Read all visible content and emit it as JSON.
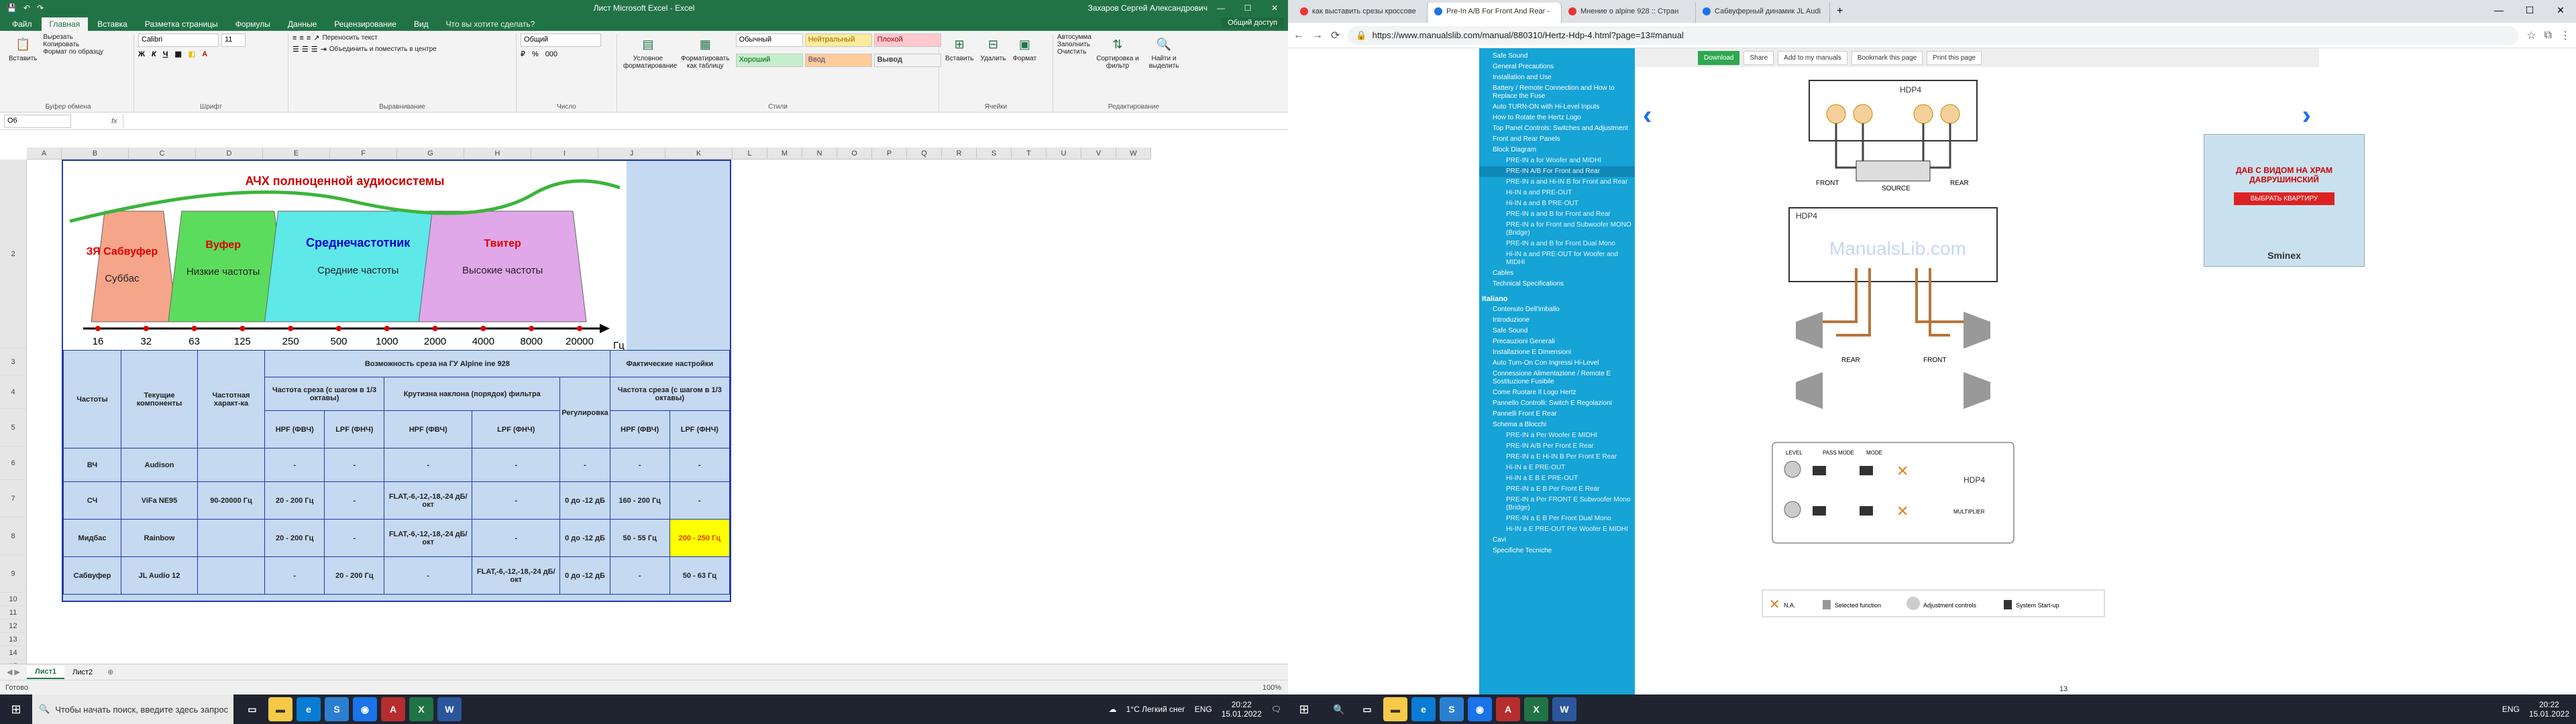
{
  "excel": {
    "title": "Лист Microsoft Excel - Excel",
    "user": "Захаров Сергей Александрович",
    "tabs": [
      "Файл",
      "Главная",
      "Вставка",
      "Разметка страницы",
      "Формулы",
      "Данные",
      "Рецензирование",
      "Вид"
    ],
    "tell_me": "Что вы хотите сделать?",
    "share": "Общий доступ",
    "ribbon": {
      "paste": "Вставить",
      "cut": "Вырезать",
      "copy": "Копировать",
      "format_painter": "Формат по образцу",
      "clipboard": "Буфер обмена",
      "font_name": "Calibri",
      "font_size": "11",
      "font_group": "Шрифт",
      "wrap": "Переносить текст",
      "merge": "Объединить и поместить в центре",
      "align_group": "Выравнивание",
      "number_format": "Общий",
      "number_group": "Число",
      "cond_format": "Условное форматирование",
      "format_table": "Форматировать как таблицу",
      "styles": [
        "Обычный",
        "Нейтральный",
        "Плохой",
        "Хороший",
        "Ввод",
        "Вывод"
      ],
      "styles_group": "Стили",
      "insert": "Вставить",
      "delete": "Удалить",
      "format": "Формат",
      "cells_group": "Ячейки",
      "autosum": "Автосумма",
      "fill": "Заполнить",
      "clear": "Очистить",
      "sort": "Сортировка и фильтр",
      "find": "Найти и выделить",
      "edit_group": "Редактирование"
    },
    "namebox": "O6",
    "fx": "fx",
    "columns": [
      "A",
      "B",
      "C",
      "D",
      "E",
      "F",
      "G",
      "H",
      "I",
      "J",
      "K",
      "L",
      "M",
      "N",
      "O",
      "P",
      "Q",
      "R",
      "S",
      "T",
      "U",
      "V",
      "W"
    ],
    "rows": [
      "2",
      "3",
      "4",
      "5",
      "6",
      "7",
      "8",
      "9",
      "10",
      "11",
      "12",
      "13",
      "14",
      "15"
    ],
    "chart": {
      "title": "АЧХ полноценной аудиосистемы",
      "bands": [
        {
          "name": "ЗЯ Сабвуфер",
          "sub": "Суббас",
          "color": "#f5a58a"
        },
        {
          "name": "Вуфер",
          "sub": "Низкие частоты",
          "color": "#5cdc5c"
        },
        {
          "name": "Среднечастотник",
          "sub": "Средние частоты",
          "color": "#5fe8e8"
        },
        {
          "name": "Твитер",
          "sub": "Высокие частоты",
          "color": "#e0a8e8"
        }
      ],
      "ticks": [
        "16",
        "32",
        "63",
        "125",
        "250",
        "500",
        "1000",
        "2000",
        "4000",
        "8000",
        "20000"
      ],
      "unit": "Гц"
    },
    "table": {
      "h_freq": "Частоты",
      "h_comp": "Текущие компоненты",
      "h_char": "Частотная характ-ка",
      "h_possible": "Возможность среза на ГУ Alpine ine 928",
      "h_actual": "Фактические настройки",
      "h_cut": "Частота среза (с шагом в 1/3 октавы)",
      "h_slope": "Крутизна наклона (порядок) фильтра",
      "h_reg": "Регулировка",
      "h_cut2": "Частота среза (с шагом в 1/3 октавы)",
      "hpf": "HPF (ФВЧ)",
      "lpf": "LPF (ФНЧ)",
      "rows": [
        [
          "ВЧ",
          "Audison",
          "",
          "-",
          "-",
          "-",
          "-",
          "-",
          "-",
          "-"
        ],
        [
          "СЧ",
          "ViFa NE95",
          "90-20000 Гц",
          "20 - 200 Гц",
          "-",
          "FLAT,-6,-12,-18,-24 дБ/окт",
          "-",
          "0 до -12 дБ",
          "160 - 200 Гц",
          "-"
        ],
        [
          "Мидбас",
          "Rainbow",
          "",
          "20 - 200 Гц",
          "-",
          "FLAT,-6,-12,-18,-24 дБ/окт",
          "-",
          "0 до -12 дБ",
          "50 - 55 Гц",
          "200 - 250 Гц"
        ],
        [
          "Сабвуфер",
          "JL Audio 12",
          "",
          "-",
          "20 - 200 Гц",
          "-",
          "FLAT,-6,-12,-18,-24 дБ/окт",
          "0 до -12 дБ",
          "-",
          "50 - 63 Гц"
        ]
      ]
    },
    "sheets": [
      "Лист1",
      "Лист2"
    ],
    "status": "Готово",
    "zoom": "100%"
  },
  "taskbar_left": {
    "search": "Чтобы начать поиск, введите здесь запрос",
    "weather": "1°C  Легкий снег",
    "lang": "ENG",
    "time": "20:22",
    "date": "15.01.2022"
  },
  "chrome": {
    "tabs": [
      "как выставить срезы кроссове",
      "Pre-In A/B For Front And Rear -",
      "Мнение о alpine 928 :: Стран",
      "Сабвуферный динамик JL Audi"
    ],
    "tab_colors": [
      "#e33",
      "#1a73e8",
      "#e33",
      "#1a73e8"
    ],
    "url": "https://www.manualslib.com/manual/880310/Hertz-Hdp-4.html?page=13#manual",
    "toolbar": [
      "Download",
      "Share",
      "Add to my manuals",
      "Bookmark this page",
      "Print this page"
    ],
    "sidebar": [
      {
        "t": "Safe Sound",
        "c": "l1"
      },
      {
        "t": "General Precautions",
        "c": "l1"
      },
      {
        "t": "Installation and Use",
        "c": "l1"
      },
      {
        "t": "Battery / Remote Connection and How to Replace the Fuse",
        "c": "l1"
      },
      {
        "t": "Auto TURN-ON with Hi-Level Inputs",
        "c": "l1"
      },
      {
        "t": "How to Rotate the Hertz Logo",
        "c": "l1"
      },
      {
        "t": "Top Panel Controls: Switches and Adjustment",
        "c": "l1"
      },
      {
        "t": "Front and Rear Panels",
        "c": "l1"
      },
      {
        "t": "Block Diagram",
        "c": "l1"
      },
      {
        "t": "PRE-IN a for Woofer and MIDHI",
        "c": "l2"
      },
      {
        "t": "PRE-IN A/B For Front and Rear",
        "c": "l2 sel"
      },
      {
        "t": "PRE-IN a and Hi-IN B for Front and Rear",
        "c": "l2"
      },
      {
        "t": "Hi-IN a and PRE-OUT",
        "c": "l2"
      },
      {
        "t": "Hi-IN a and B PRE-OUT",
        "c": "l2"
      },
      {
        "t": "PRE-IN a and B for Front and Rear",
        "c": "l2"
      },
      {
        "t": "PRE-IN a for Front and Subwoofer MONO (Bridge)",
        "c": "l2"
      },
      {
        "t": "PRE-IN a and B for Front Dual Mono",
        "c": "l2"
      },
      {
        "t": "Hi-IN a and PRE-OUT for Woofer and MIDHI",
        "c": "l2"
      },
      {
        "t": "Cables",
        "c": "l1"
      },
      {
        "t": "Technical Specifications",
        "c": "l1"
      },
      {
        "t": "Italiano",
        "c": "sec"
      },
      {
        "t": "Contenuto Dell'imballo",
        "c": "l1"
      },
      {
        "t": "Introduzione",
        "c": "l1"
      },
      {
        "t": "Safe Sound",
        "c": "l1"
      },
      {
        "t": "Precauzioni Generali",
        "c": "l1"
      },
      {
        "t": "Installazione E Dimensioni",
        "c": "l1"
      },
      {
        "t": "Auto Turn-On Con Ingressi Hi-Level",
        "c": "l1"
      },
      {
        "t": "Connessione Alimentazione / Remote E Sostituzione Fusibile",
        "c": "l1"
      },
      {
        "t": "Come Ruotare Il Logo Hertz",
        "c": "l1"
      },
      {
        "t": "Pannello Controlli: Switch E Regolazioni",
        "c": "l1"
      },
      {
        "t": "Pannelli Front E Rear",
        "c": "l1"
      },
      {
        "t": "Schema a Blocchi",
        "c": "l1"
      },
      {
        "t": "PRE-IN a Per Woofer E MIDHI",
        "c": "l2"
      },
      {
        "t": "PRE-IN A/B Per Front E Rear",
        "c": "l2"
      },
      {
        "t": "PRE-IN a E Hi-IN B Per Front E Rear",
        "c": "l2"
      },
      {
        "t": "Hi-IN a E PRE-OUT",
        "c": "l2"
      },
      {
        "t": "Hi-IN a E B E PRE-OUT",
        "c": "l2"
      },
      {
        "t": "PRE-IN a E B Per Front E Rear",
        "c": "l2"
      },
      {
        "t": "PRE-IN a Per FRONT E Subwoofer Mono (Bridge)",
        "c": "l2"
      },
      {
        "t": "PRE-IN a E B Per Front Dual Mono",
        "c": "l2"
      },
      {
        "t": "Hi-IN a E PRE-OUT Per Woofer E MIDHI",
        "c": "l2"
      },
      {
        "t": "Cavi",
        "c": "l1"
      },
      {
        "t": "Specifiche Tecniche",
        "c": "l1"
      }
    ],
    "diagram": {
      "hdp4": "HDP4",
      "front": "FRONT",
      "rear": "REAR",
      "source": "SOURCE",
      "watermark": "ManualsLib.com",
      "level": "LEVEL",
      "pass_mode": "PASS MODE",
      "mode": "MODE",
      "multiplier": "MULTIPLIER",
      "legend_na": "N.A.",
      "legend_sel": "Selected function",
      "legend_adj": "Adjustment controls",
      "legend_sys": "System Start-up"
    },
    "ad": {
      "text": "ДАВ С ВИДОМ НА ХРАМ ДАВРУШИНСКИЙ",
      "button": "ВЫБРАТЬ КВАРТИРУ",
      "brand": "Sminex"
    },
    "page_number": "13"
  },
  "taskbar_right": {
    "time": "20:22",
    "date": "15.01.2022",
    "lang": "ENG"
  }
}
